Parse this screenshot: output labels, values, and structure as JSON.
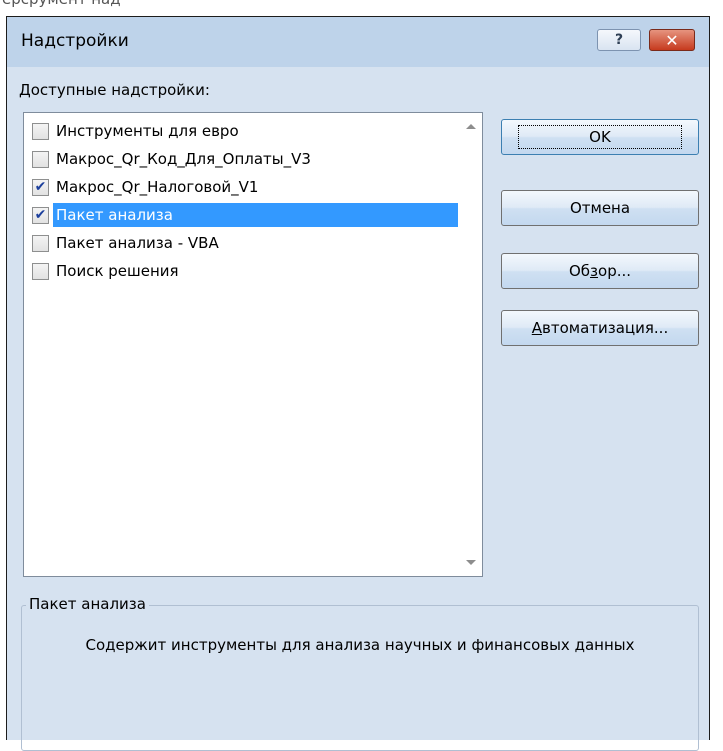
{
  "top_clip_text": "ерсрумент над",
  "dialog": {
    "title": "Надстройки",
    "help_glyph": "?",
    "close_glyph": "✕"
  },
  "list": {
    "label_prefix": "Д",
    "label_rest": "оступные надстройки:",
    "items": [
      {
        "label": "Инструменты для евро",
        "checked": false,
        "selected": false
      },
      {
        "label": "Макрос_Qr_Код_Для_Оплаты_V3",
        "checked": false,
        "selected": false
      },
      {
        "label": "Макрос_Qr_Налоговой_V1",
        "checked": true,
        "selected": false
      },
      {
        "label": "Пакет анализа",
        "checked": true,
        "selected": true
      },
      {
        "label": "Пакет анализа - VBA",
        "checked": false,
        "selected": false
      },
      {
        "label": "Поиск решения",
        "checked": false,
        "selected": false
      }
    ]
  },
  "buttons": {
    "ok": "OK",
    "cancel": "Отмена",
    "browse_pre": "Об",
    "browse_u": "з",
    "browse_post": "ор...",
    "auto_u": "А",
    "auto_post": "втоматизация..."
  },
  "description": {
    "title": "Пакет анализа",
    "text": "Содержит инструменты для анализа научных и финансовых данных"
  },
  "colors": {
    "selection": "#3399ff",
    "checkmark": "#1c3f9c",
    "close_button": "#c63a1e"
  }
}
